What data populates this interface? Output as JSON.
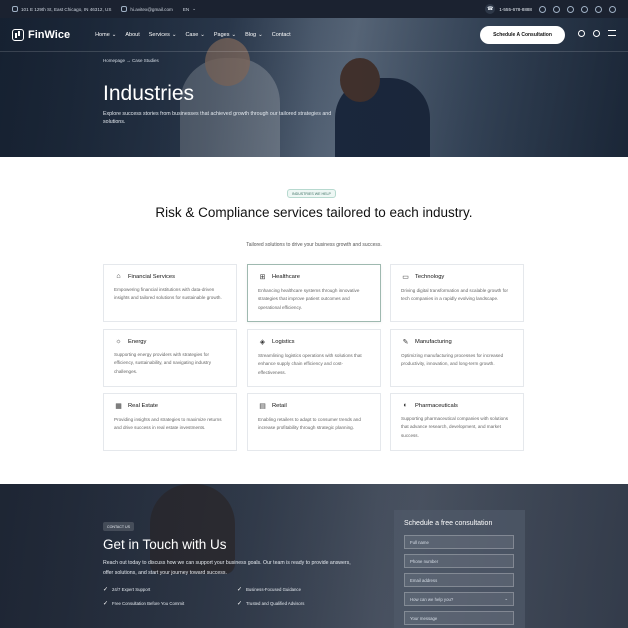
{
  "topbar": {
    "address": "101 E 129th St, East Chicago, IN 46312, US",
    "email": "hi.avitex@gmail.com",
    "language": "EN",
    "phone": "1-555-678-8888",
    "socials": [
      "whatsapp-icon",
      "skype-icon",
      "x-icon",
      "instagram-icon",
      "facebook-icon",
      "telegram-icon"
    ]
  },
  "nav": {
    "brand": "FinWice",
    "items": [
      "Home",
      "About",
      "Services",
      "Case",
      "Pages",
      "Blog",
      "Contact"
    ],
    "cta": "Schedule A Consultation"
  },
  "hero": {
    "breadcrumb": "Homepage  →  Case Studies",
    "title": "Industries",
    "subtitle": "Explore success stories from businesses that achieved growth through our tailored strategies and solutions."
  },
  "industries": {
    "badge": "INDUSTRIES WE HELP",
    "title": "Risk & Compliance services tailored to each industry.",
    "subtitle": "Tailored solutions to drive your business growth and success.",
    "cards": [
      {
        "icon": "bank-icon",
        "title": "Financial Services",
        "desc": "Empowering financial institutions with data-driven insights and tailored solutions for sustainable growth."
      },
      {
        "icon": "medical-case-icon",
        "title": "Healthcare",
        "desc": "Enhancing healthcare systems through innovative strategies that improve patient outcomes and operational efficiency."
      },
      {
        "icon": "monitor-icon",
        "title": "Technology",
        "desc": "Driving digital transformation and scalable growth for tech companies in a rapidly evolving landscape."
      },
      {
        "icon": "lightbulb-icon",
        "title": "Energy",
        "desc": "Supporting energy providers with strategies for efficiency, sustainability, and navigating industry challenges."
      },
      {
        "icon": "truck-icon",
        "title": "Logistics",
        "desc": "Streamlining logistics operations with solutions that enhance supply chain efficiency and cost-effectiveness."
      },
      {
        "icon": "tools-icon",
        "title": "Manufacturing",
        "desc": "Optimizing manufacturing processes for increased productivity, innovation, and long-term growth."
      },
      {
        "icon": "building-icon",
        "title": "Real Estate",
        "desc": "Providing insights and strategies to maximize returns and drive success in real estate investments."
      },
      {
        "icon": "store-icon",
        "title": "Retail",
        "desc": "Enabling retailers to adapt to consumer trends and increase profitability through strategic planning."
      },
      {
        "icon": "pill-icon",
        "title": "Pharmaceuticals",
        "desc": "Supporting pharmaceutical companies with solutions that advance research, development, and market success."
      }
    ]
  },
  "contact": {
    "badge": "CONTACT US",
    "title": "Get in Touch with Us",
    "desc": "Reach out today to discuss how we can support your business goals. Our team is ready to provide answers, offer solutions, and start your journey toward success.",
    "features": [
      "24/7 Expert Support",
      "Business-Focused Guidance",
      "Free Consultation Before You Commit",
      "Trusted and Qualified Advisors"
    ],
    "form": {
      "title": "Schedule a free consultation",
      "fields": [
        "Full name",
        "Phone number",
        "Email address",
        "How can we help you?",
        "Your message"
      ]
    }
  }
}
